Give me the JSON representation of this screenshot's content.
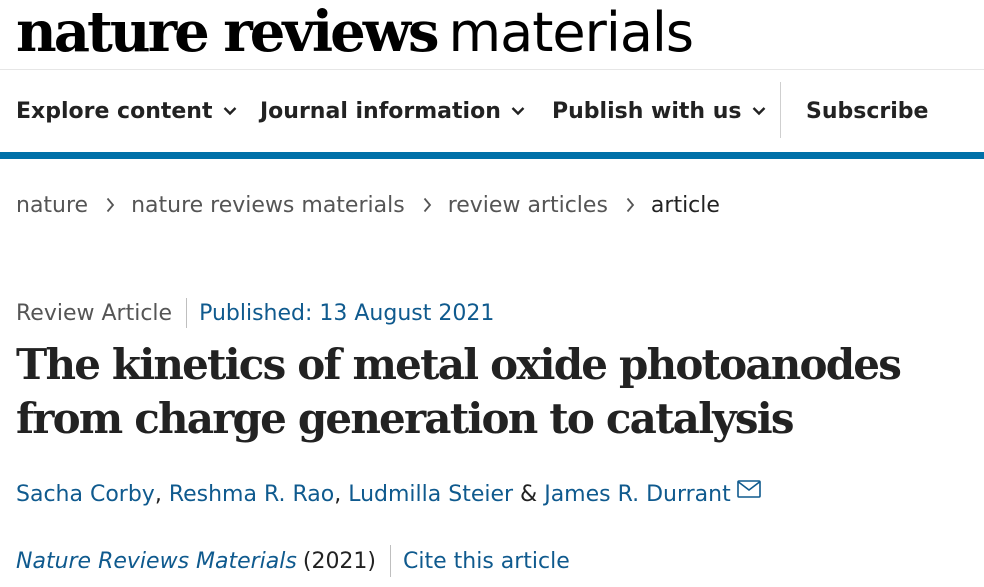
{
  "header": {
    "logo_bold": "nature reviews",
    "logo_light": "materials"
  },
  "nav": {
    "items": [
      {
        "label": "Explore content",
        "icon": "chevron-down-icon"
      },
      {
        "label": "Journal information",
        "icon": "chevron-down-icon"
      },
      {
        "label": "Publish with us",
        "icon": "chevron-down-icon"
      }
    ],
    "subscribe": "Subscribe",
    "bar_color": "#0070a8"
  },
  "breadcrumb": {
    "items": [
      "nature",
      "nature reviews materials",
      "review articles",
      "article"
    ],
    "separator_icon": "chevron-right-icon"
  },
  "article": {
    "type": "Review Article",
    "published": "Published: 13 August 2021",
    "title": "The kinetics of metal oxide photoanodes from charge generation to catalysis",
    "authors": [
      "Sacha Corby",
      "Reshma R. Rao",
      "Ludmilla Steier",
      "James R. Durrant"
    ],
    "author_separators": [
      ", ",
      ", ",
      " & "
    ],
    "contact_icon": "mail-icon",
    "journal": "Nature Reviews Materials",
    "year": "(2021)",
    "cite": "Cite this article",
    "link_color": "#0f5a8e"
  }
}
